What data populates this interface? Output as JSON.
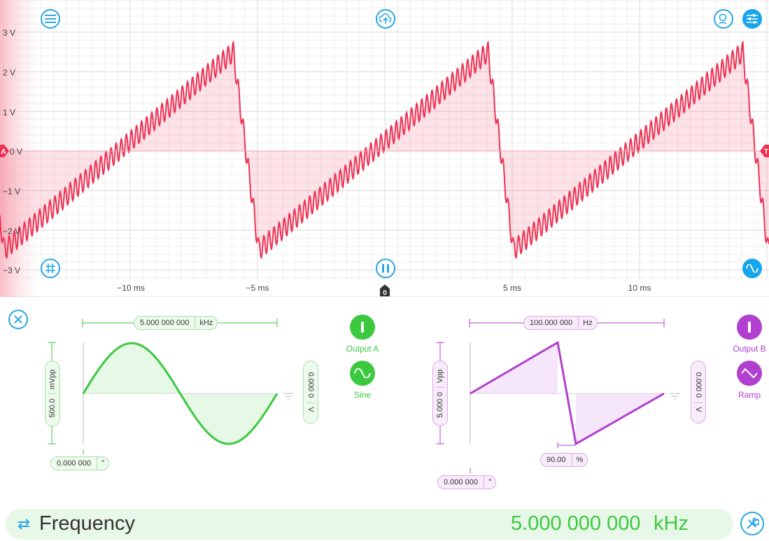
{
  "scope": {
    "y_labels": [
      "3 V",
      "2 V",
      "1 V",
      "0 V",
      "−1 V",
      "−2 V",
      "−3 V"
    ],
    "x_labels": [
      "−10 ms",
      "−5 ms",
      "0",
      "5 ms",
      "10 ms"
    ],
    "trace_color": "#ee3355",
    "channel_marker": "A",
    "trigger_marker": "T",
    "buttons": {
      "menu": "menu-icon",
      "cloud": "cloud-upload-icon",
      "search": "search-icon",
      "settings": "sliders-icon",
      "grid": "grid-icon",
      "pause": "pause-icon",
      "wave": "sine-wave-icon"
    }
  },
  "generator": {
    "close_icon": "close-icon",
    "channel_a": {
      "frequency": "5.000 000 000",
      "frequency_unit": "kHz",
      "amplitude": "500.0",
      "amplitude_unit": "mVpp",
      "offset": "0.000 0",
      "offset_unit": "V",
      "phase": "0.000 000",
      "phase_unit": "°",
      "output_label": "Output A",
      "output_icon": "power-icon",
      "wave_label": "Sine",
      "wave_icon": "sine-wave-icon",
      "color": "#3cc940"
    },
    "channel_b": {
      "frequency": "100.000 000",
      "frequency_unit": "Hz",
      "amplitude": "5.000 0",
      "amplitude_unit": "Vpp",
      "offset": "0.000 0",
      "offset_unit": "V",
      "phase": "0.000 000",
      "phase_unit": "°",
      "symmetry": "90.00",
      "symmetry_unit": "%",
      "output_label": "Output B",
      "output_icon": "power-icon",
      "wave_label": "Ramp",
      "wave_icon": "triangle-wave-icon",
      "color": "#b140d0"
    }
  },
  "bottom": {
    "swap_icon": "swap-arrows-icon",
    "param_label": "Frequency",
    "value": "5.000 000 000",
    "unit": "kHz",
    "tools_icon": "tools-icon"
  }
}
